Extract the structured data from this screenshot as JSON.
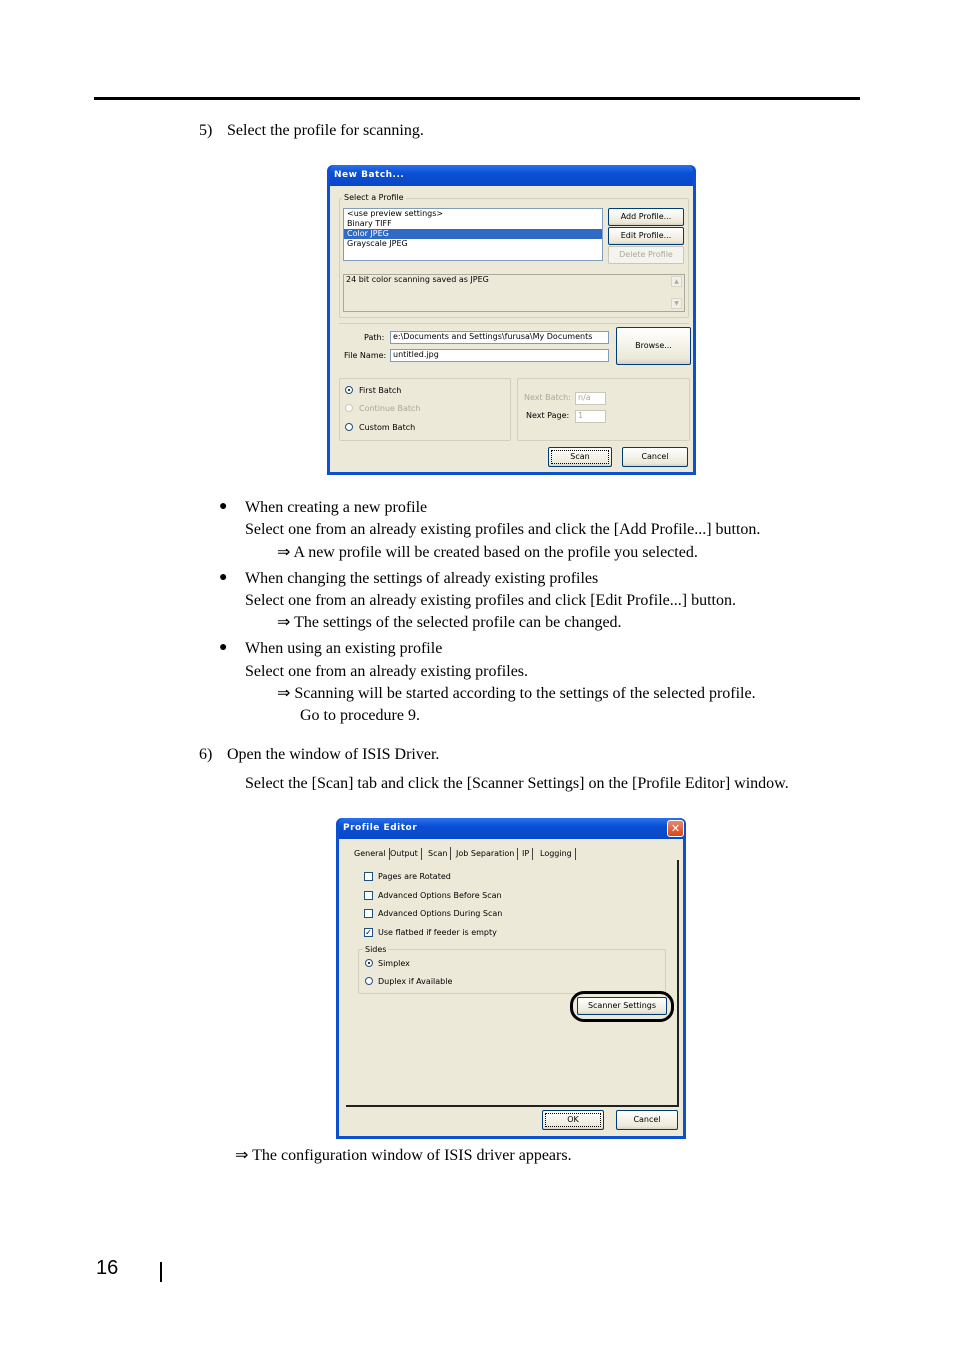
{
  "step5": {
    "number": "5)",
    "text": "Select the profile for scanning."
  },
  "new_batch_dialog": {
    "title": "New Batch...",
    "select_profile_label": "Select a Profile",
    "profiles": [
      {
        "label": "<use preview settings>",
        "selected": false
      },
      {
        "label": "Binary TIFF",
        "selected": false
      },
      {
        "label": "Color JPEG",
        "selected": true
      },
      {
        "label": "Grayscale JPEG",
        "selected": false
      }
    ],
    "add_profile_label": "Add Profile...",
    "edit_profile_label": "Edit Profile...",
    "delete_profile_label": "Delete Profile",
    "description": "24 bit color scanning saved as JPEG",
    "path_label": "Path:",
    "path_value": "e:\\Documents and Settings\\furusa\\My Documents",
    "file_name_label": "File Name:",
    "file_name_value": "untitled.jpg",
    "browse_label": "Browse...",
    "batch_options": [
      {
        "label": "First Batch",
        "checked": true,
        "enabled": true
      },
      {
        "label": "Continue Batch",
        "checked": false,
        "enabled": false
      },
      {
        "label": "Custom Batch",
        "checked": false,
        "enabled": true
      }
    ],
    "next_batch_label": "Next Batch:",
    "next_batch_value": "n/a",
    "next_page_label": "Next Page:",
    "next_page_value": "1",
    "scan_label": "Scan",
    "cancel_label": "Cancel"
  },
  "bullets": [
    {
      "heading": "When creating a new profile",
      "instruction": "Select one from an already existing profiles and click the [Add Profile...] button.",
      "result": "⇒ A new profile will be created based on the profile you selected.",
      "result2": ""
    },
    {
      "heading": "When changing the settings of already existing profiles",
      "instruction": "Select one from an already existing profiles and click [Edit Profile...] button.",
      "result": "⇒ The settings of the selected profile can be changed.",
      "result2": ""
    },
    {
      "heading": "When using an existing profile",
      "instruction": "Select one from an already existing profiles.",
      "result": "⇒ Scanning will be started according to the settings of the selected profile.",
      "result2": "Go to procedure 9."
    }
  ],
  "step6": {
    "number": "6)",
    "text": "Open the window of ISIS Driver.",
    "instruction": "Select the [Scan] tab and click the [Scanner Settings] on the [Profile Editor] window."
  },
  "profile_editor_dialog": {
    "title": "Profile Editor",
    "tabs": [
      {
        "label": "General",
        "active": false
      },
      {
        "label": "Output",
        "active": false
      },
      {
        "label": "Scan",
        "active": true
      },
      {
        "label": "Job Separation",
        "active": false
      },
      {
        "label": "IP",
        "active": false
      },
      {
        "label": "Logging",
        "active": false
      }
    ],
    "checkboxes": [
      {
        "label": "Pages are Rotated",
        "checked": false
      },
      {
        "label": "Advanced Options Before Scan",
        "checked": false
      },
      {
        "label": "Advanced Options During Scan",
        "checked": false
      },
      {
        "label": "Use flatbed if feeder is empty",
        "checked": true
      }
    ],
    "sides_label": "Sides",
    "sides_options": [
      {
        "label": "Simplex",
        "checked": true
      },
      {
        "label": "Duplex if Available",
        "checked": false
      }
    ],
    "scanner_settings_label": "Scanner Settings",
    "ok_label": "OK",
    "cancel_label": "Cancel"
  },
  "result_text": "⇒ The configuration window of ISIS driver appears.",
  "page_number": "16"
}
